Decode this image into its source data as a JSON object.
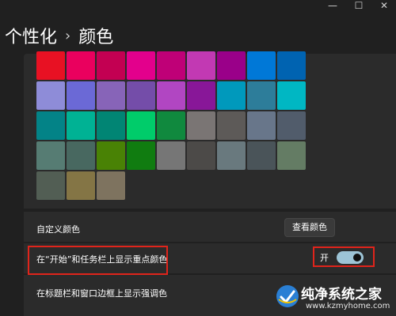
{
  "breadcrumb": {
    "parent": "个性化",
    "separator": "›",
    "current": "颜色"
  },
  "window_controls": {
    "minimize_glyph": "—",
    "maximize_glyph": "☐",
    "close_glyph": "✕"
  },
  "color_swatches": [
    "#e81123",
    "#ea005e",
    "#c30052",
    "#e3008c",
    "#bf0077",
    "#c239b3",
    "#9a0089",
    "#0078d7",
    "#0063b1",
    "#8e8cd8",
    "#6b69d6",
    "#8764b8",
    "#744da9",
    "#b146c2",
    "#881798",
    "#0099bc",
    "#2d7d9a",
    "#00b7c3",
    "#038387",
    "#00b294",
    "#018574",
    "#00cc6a",
    "#10893e",
    "#7a7574",
    "#5d5a58",
    "#68768a",
    "#515c6b",
    "#567c73",
    "#486860",
    "#498205",
    "#107c10",
    "#767676",
    "#4c4a48",
    "#69797e",
    "#4a5459",
    "#647c64",
    "#525e54",
    "#847545",
    "#7e735f"
  ],
  "custom_color": {
    "label": "自定义颜色",
    "button_label": "查看颜色"
  },
  "accent_start_taskbar": {
    "label": "在“开始”和任务栏上显示重点颜色",
    "toggle_state_label": "开",
    "toggle_on": true
  },
  "accent_title_bars": {
    "label": "在标题栏和窗口边框上显示强调色"
  },
  "watermark": {
    "title": "纯净系统之家",
    "url": "www.kzmyhome.com"
  },
  "colors": {
    "background": "#202020",
    "card": "#2b2b2b",
    "highlight_border": "#e0241b",
    "toggle_on": "#9dc4d6"
  }
}
